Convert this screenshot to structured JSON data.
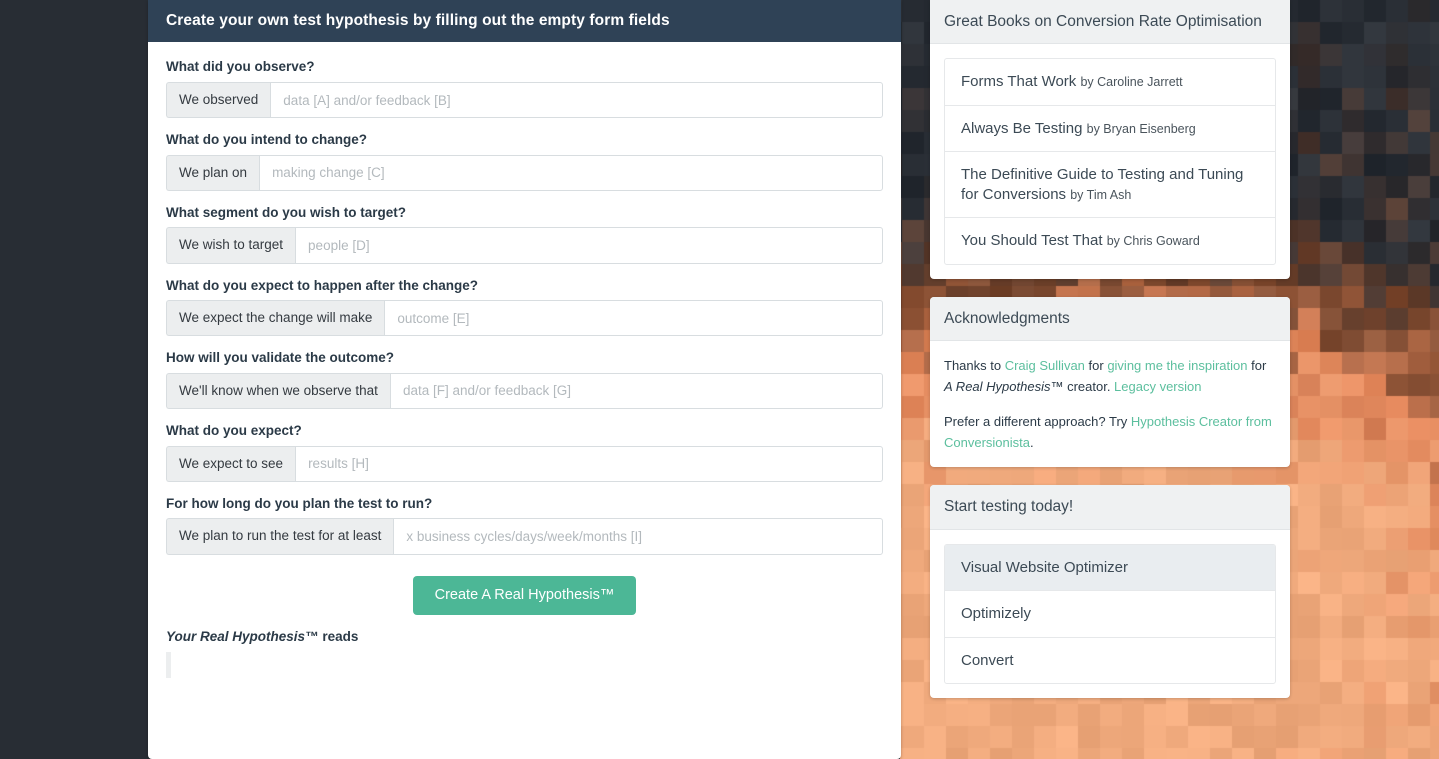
{
  "theme": {
    "header_bg": "#2f4256",
    "accent_green": "#4cb796",
    "link_green": "#5cbf9e",
    "addon_bg": "#eceeef",
    "panel_heading_bg": "#eff1f2",
    "page_dark_bg": "#282d34",
    "page_photo_accent": "#e2865a"
  },
  "form": {
    "header_title": "Create your own test hypothesis by filling out the empty form fields",
    "fields": [
      {
        "label": "What did you observe?",
        "addon": "We observed",
        "value": "",
        "placeholder": "data [A] and/or feedback [B]"
      },
      {
        "label": "What do you intend to change?",
        "addon": "We plan on",
        "value": "",
        "placeholder": "making change [C]"
      },
      {
        "label": "What segment do you wish to target?",
        "addon": "We wish to target",
        "value": "",
        "placeholder": "people [D]"
      },
      {
        "label": "What do you expect to happen after the change?",
        "addon": "We expect the change will make",
        "value": "",
        "placeholder": "outcome [E]"
      },
      {
        "label": "How will you validate the outcome?",
        "addon": "We'll know when we observe that",
        "value": "",
        "placeholder": "data [F] and/or feedback [G]"
      },
      {
        "label": "What do you expect?",
        "addon": "We expect to see",
        "value": "",
        "placeholder": "results [H]"
      },
      {
        "label": "For how long do you plan the test to run?",
        "addon": "We plan to run the test for at least",
        "value": "",
        "placeholder": "x business cycles/days/week/months [I]"
      }
    ],
    "submit_label": "Create A Real Hypothesis™",
    "result_label_italic": "Your Real Hypothesis™",
    "result_label_bold": "reads",
    "result_text": ""
  },
  "sidebar": {
    "books_panel": {
      "title": "Great Books on Conversion Rate Optimisation",
      "items": [
        {
          "title": "Forms That Work",
          "author": "by Caroline Jarrett"
        },
        {
          "title": "Always Be Testing",
          "author": "by Bryan Eisenberg"
        },
        {
          "title": "The Definitive Guide to Testing and Tuning for Conversions",
          "author": "by Tim Ash"
        },
        {
          "title": "You Should Test That",
          "author": "by Chris Goward"
        }
      ]
    },
    "acknowledgments_panel": {
      "title": "Acknowledgments",
      "p1": {
        "t1": "Thanks to ",
        "link1": "Craig Sullivan",
        "t2": " for ",
        "link2": "giving me the inspiration",
        "t3": " for ",
        "italic": "A Real Hypothesis™",
        "t4": " creator. ",
        "link3": "Legacy version"
      },
      "p2": {
        "t1": "Prefer a different approach? Try ",
        "link1": "Hypothesis Creator from Conversionista",
        "t2": "."
      }
    },
    "tools_panel": {
      "title": "Start testing today!",
      "items": [
        {
          "label": "Visual Website Optimizer",
          "active": true
        },
        {
          "label": "Optimizely",
          "active": false
        },
        {
          "label": "Convert",
          "active": false
        }
      ]
    }
  }
}
